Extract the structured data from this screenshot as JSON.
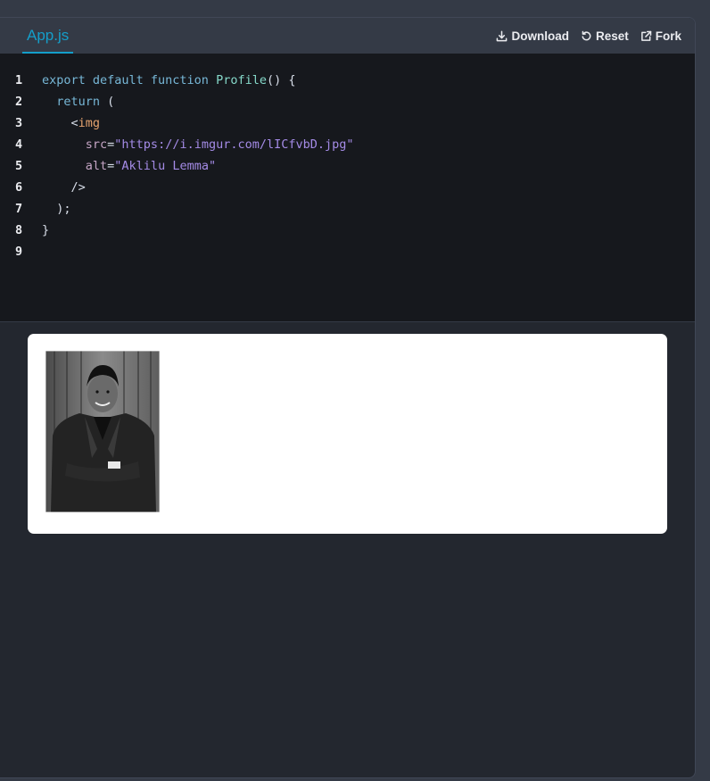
{
  "editor": {
    "active_tab": "App.js",
    "actions": {
      "download": "Download",
      "reset": "Reset",
      "fork": "Fork"
    },
    "lines": [
      {
        "num": "1",
        "tokens": [
          {
            "t": "export default function ",
            "c": "kw"
          },
          {
            "t": "Profile",
            "c": "fn"
          },
          {
            "t": "() {",
            "c": "pn"
          }
        ]
      },
      {
        "num": "2",
        "tokens": [
          {
            "t": "  return ",
            "c": "kw"
          },
          {
            "t": "(",
            "c": "pn"
          }
        ]
      },
      {
        "num": "3",
        "tokens": [
          {
            "t": "    <",
            "c": "pn"
          },
          {
            "t": "img",
            "c": "tg"
          }
        ]
      },
      {
        "num": "4",
        "tokens": [
          {
            "t": "      src",
            "c": "at"
          },
          {
            "t": "=",
            "c": "pn"
          },
          {
            "t": "\"https://i.imgur.com/lICfvbD.jpg\"",
            "c": "st"
          }
        ]
      },
      {
        "num": "5",
        "tokens": [
          {
            "t": "      alt",
            "c": "at"
          },
          {
            "t": "=",
            "c": "pn"
          },
          {
            "t": "\"Aklilu Lemma\"",
            "c": "st"
          }
        ]
      },
      {
        "num": "6",
        "tokens": [
          {
            "t": "    />",
            "c": "pn"
          }
        ]
      },
      {
        "num": "7",
        "tokens": [
          {
            "t": "  );",
            "c": "pn"
          }
        ]
      },
      {
        "num": "8",
        "tokens": [
          {
            "t": "}",
            "c": "pn"
          }
        ]
      },
      {
        "num": "9",
        "tokens": []
      }
    ]
  },
  "preview": {
    "image_icon": "portrait-photo-icon"
  }
}
